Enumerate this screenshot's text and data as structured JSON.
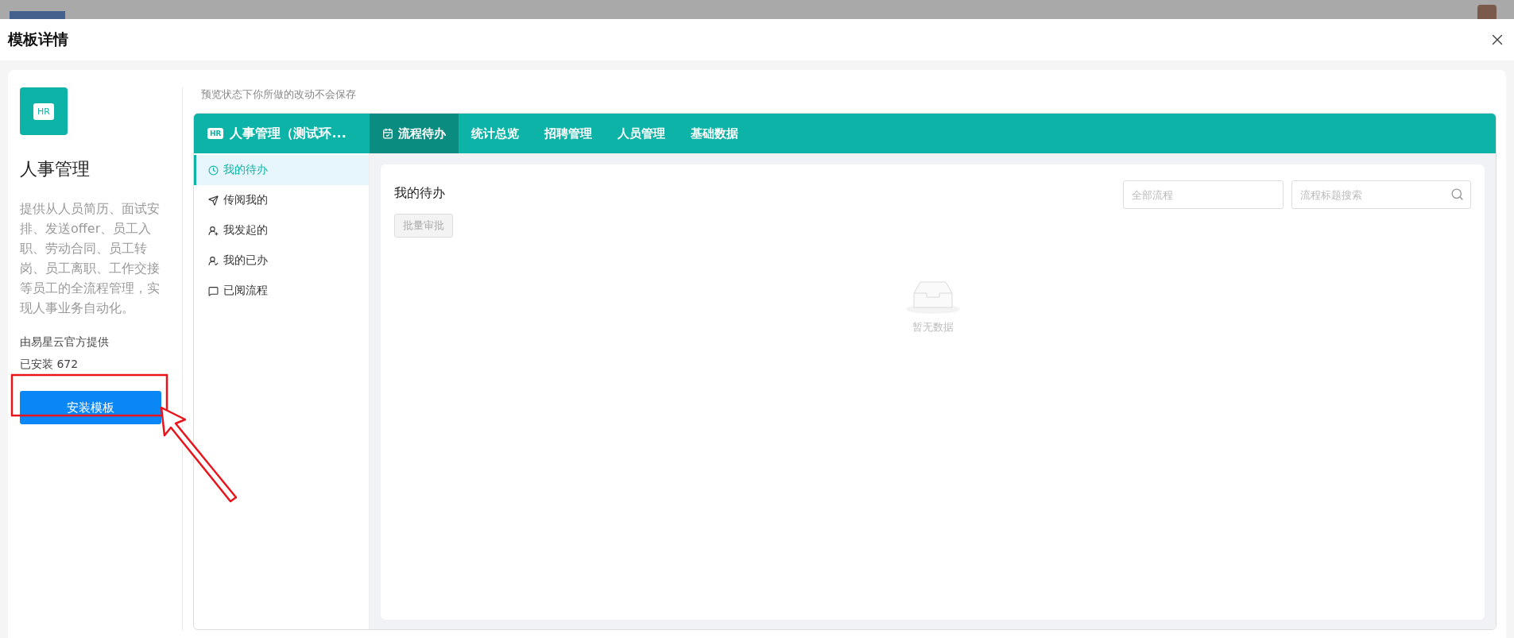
{
  "modal": {
    "title": "模板详情"
  },
  "template": {
    "badge": "HR",
    "name": "人事管理",
    "description": "提供从人员简历、面试安排、发送offer、员工入职、劳动合同、员工转岗、员工离职、工作交接等员工的全流程管理，实现人事业务自动化。",
    "provider": "由易星云官方提供",
    "installs": "已安装 672",
    "install_button": "安装模板"
  },
  "preview_note": "预览状态下你所做的改动不会保存",
  "app": {
    "badge": "HR",
    "name": "人事管理（测试环...",
    "tabs": [
      {
        "label": "流程待办",
        "selected": true
      },
      {
        "label": "统计总览",
        "selected": false
      },
      {
        "label": "招聘管理",
        "selected": false
      },
      {
        "label": "人员管理",
        "selected": false
      },
      {
        "label": "基础数据",
        "selected": false
      }
    ],
    "menu": [
      {
        "label": "我的待办",
        "selected": true
      },
      {
        "label": "传阅我的",
        "selected": false
      },
      {
        "label": "我发起的",
        "selected": false
      },
      {
        "label": "我的已办",
        "selected": false
      },
      {
        "label": "已阅流程",
        "selected": false
      }
    ],
    "content": {
      "title": "我的待办",
      "batch_button": {
        "label": "批量审批",
        "disabled": true
      },
      "filter": {
        "placeholder": "全部流程"
      },
      "search": {
        "placeholder": "流程标题搜索"
      },
      "empty_text": "暂无数据"
    }
  }
}
